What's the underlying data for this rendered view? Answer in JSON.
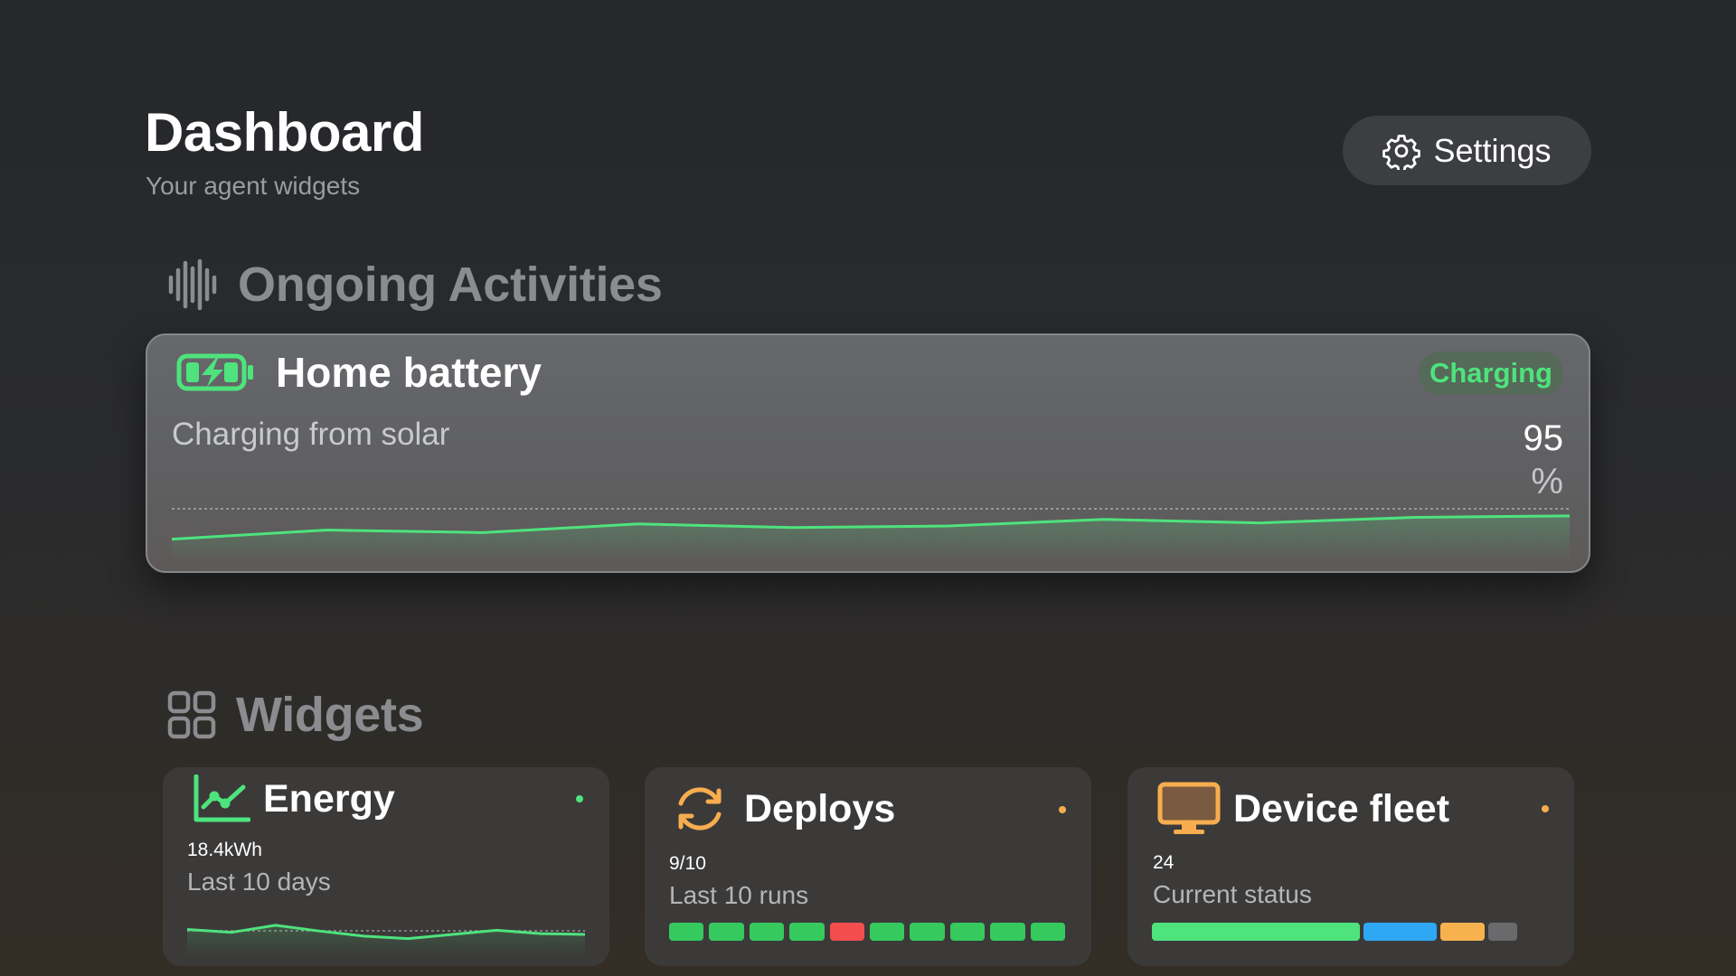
{
  "header": {
    "title": "Dashboard",
    "subtitle": "Your agent widgets",
    "settings_label": "Settings",
    "settings_icon": "gear-icon"
  },
  "sections": {
    "activities": {
      "label": "Ongoing Activities",
      "icon": "waveform-icon"
    },
    "widgets": {
      "label": "Widgets",
      "icon": "grid-icon"
    }
  },
  "activity": {
    "icon": "battery-charging-icon",
    "title": "Home battery",
    "status": "Charging",
    "description": "Charging from solar",
    "value": "95",
    "unit": "%",
    "trend": [
      40,
      58,
      53,
      70,
      63,
      66,
      79,
      72,
      83,
      86
    ],
    "colors": {
      "accent": "#4ee37d",
      "pill_bg": "#556a58"
    }
  },
  "widgets": {
    "energy": {
      "icon": "line-chart-icon",
      "title": "Energy",
      "value": "18.4kWh",
      "caption": "Last 10 days",
      "trend": [
        62,
        55,
        72,
        58,
        46,
        40,
        50,
        60,
        52,
        50
      ],
      "dot_color": "#4ee37d"
    },
    "deploys": {
      "icon": "sync-arrows-icon",
      "title": "Deploys",
      "value": "9/10",
      "caption": "Last 10 runs",
      "runs": [
        "success",
        "success",
        "success",
        "success",
        "failure",
        "success",
        "success",
        "success",
        "success",
        "success"
      ],
      "dot_color": "#f7ad4f",
      "colors": {
        "success": "#35c95e",
        "failure": "#f34d4d"
      }
    },
    "fleet": {
      "icon": "monitor-icon",
      "title": "Device fleet",
      "value": "24",
      "caption": "Current status",
      "dot_color": "#f7ad4f",
      "segments": [
        {
          "status": "online",
          "share": 0.54,
          "color": "#4ee37d"
        },
        {
          "status": "updating",
          "share": 0.19,
          "color": "#2ea8f3"
        },
        {
          "status": "warning",
          "share": 0.115,
          "color": "#f7b24f"
        },
        {
          "status": "offline",
          "share": 0.075,
          "color": "#6a6a6c"
        }
      ]
    }
  }
}
